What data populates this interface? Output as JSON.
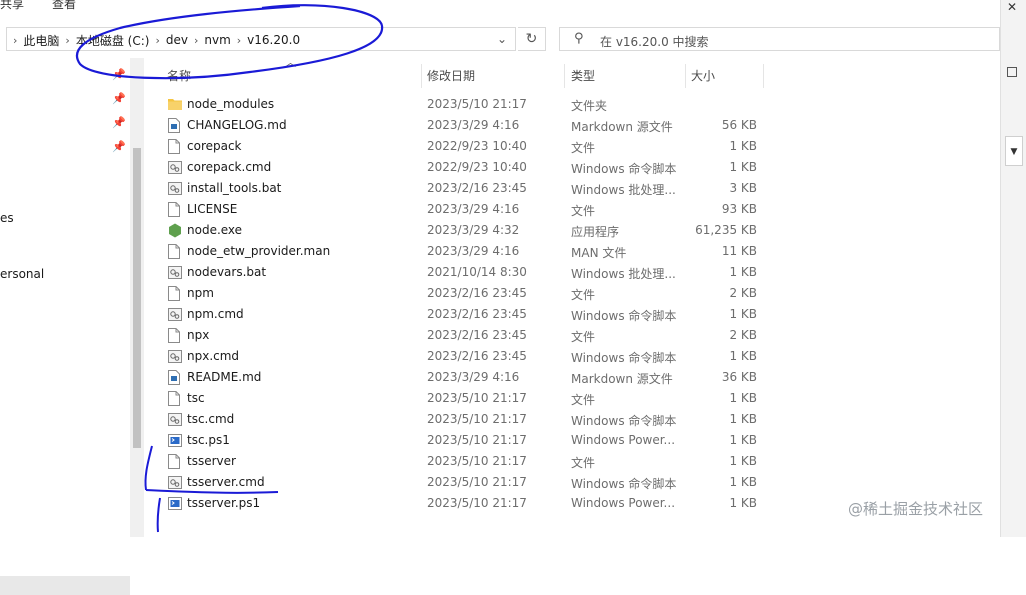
{
  "ribbon": {
    "tab_share": "共享",
    "tab_view": "查看"
  },
  "address": {
    "crumbs": [
      "此电脑",
      "本地磁盘 (C:)",
      "dev",
      "nvm",
      "v16.20.0"
    ]
  },
  "search": {
    "placeholder": "在 v16.20.0 中搜索"
  },
  "nav": {
    "partial_items": [
      "es",
      "ersonal"
    ]
  },
  "columns": {
    "name": "名称",
    "date": "修改日期",
    "type": "类型",
    "size": "大小"
  },
  "files": [
    {
      "name": "node_modules",
      "date": "2023/5/10 21:17",
      "type": "文件夹",
      "size": "",
      "icon": "folder-icon"
    },
    {
      "name": "CHANGELOG.md",
      "date": "2023/3/29 4:16",
      "type": "Markdown 源文件",
      "size": "56 KB",
      "icon": "markdown-file-icon"
    },
    {
      "name": "corepack",
      "date": "2022/9/23 10:40",
      "type": "文件",
      "size": "1 KB",
      "icon": "file-icon"
    },
    {
      "name": "corepack.cmd",
      "date": "2022/9/23 10:40",
      "type": "Windows 命令脚本",
      "size": "1 KB",
      "icon": "script-file-icon"
    },
    {
      "name": "install_tools.bat",
      "date": "2023/2/16 23:45",
      "type": "Windows 批处理...",
      "size": "3 KB",
      "icon": "script-file-icon"
    },
    {
      "name": "LICENSE",
      "date": "2023/3/29 4:16",
      "type": "文件",
      "size": "93 KB",
      "icon": "file-icon"
    },
    {
      "name": "node.exe",
      "date": "2023/3/29 4:32",
      "type": "应用程序",
      "size": "61,235 KB",
      "icon": "node-exe-icon"
    },
    {
      "name": "node_etw_provider.man",
      "date": "2023/3/29 4:16",
      "type": "MAN 文件",
      "size": "11 KB",
      "icon": "file-icon"
    },
    {
      "name": "nodevars.bat",
      "date": "2021/10/14 8:30",
      "type": "Windows 批处理...",
      "size": "1 KB",
      "icon": "script-file-icon"
    },
    {
      "name": "npm",
      "date": "2023/2/16 23:45",
      "type": "文件",
      "size": "2 KB",
      "icon": "file-icon"
    },
    {
      "name": "npm.cmd",
      "date": "2023/2/16 23:45",
      "type": "Windows 命令脚本",
      "size": "1 KB",
      "icon": "script-file-icon"
    },
    {
      "name": "npx",
      "date": "2023/2/16 23:45",
      "type": "文件",
      "size": "2 KB",
      "icon": "file-icon"
    },
    {
      "name": "npx.cmd",
      "date": "2023/2/16 23:45",
      "type": "Windows 命令脚本",
      "size": "1 KB",
      "icon": "script-file-icon"
    },
    {
      "name": "README.md",
      "date": "2023/3/29 4:16",
      "type": "Markdown 源文件",
      "size": "36 KB",
      "icon": "markdown-file-icon"
    },
    {
      "name": "tsc",
      "date": "2023/5/10 21:17",
      "type": "文件",
      "size": "1 KB",
      "icon": "file-icon"
    },
    {
      "name": "tsc.cmd",
      "date": "2023/5/10 21:17",
      "type": "Windows 命令脚本",
      "size": "1 KB",
      "icon": "script-file-icon"
    },
    {
      "name": "tsc.ps1",
      "date": "2023/5/10 21:17",
      "type": "Windows Power...",
      "size": "1 KB",
      "icon": "powershell-file-icon"
    },
    {
      "name": "tsserver",
      "date": "2023/5/10 21:17",
      "type": "文件",
      "size": "1 KB",
      "icon": "file-icon"
    },
    {
      "name": "tsserver.cmd",
      "date": "2023/5/10 21:17",
      "type": "Windows 命令脚本",
      "size": "1 KB",
      "icon": "script-file-icon"
    },
    {
      "name": "tsserver.ps1",
      "date": "2023/5/10 21:17",
      "type": "Windows Power...",
      "size": "1 KB",
      "icon": "powershell-file-icon"
    }
  ],
  "watermark": "@稀土掘金技术社区",
  "colors": {
    "annotation_ink": "#1a1ad6",
    "folder": "#f5c542",
    "node_green": "#5fa04e"
  }
}
